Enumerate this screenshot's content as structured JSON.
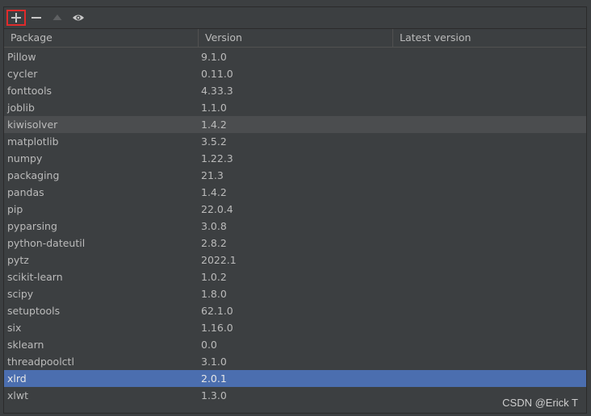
{
  "columns": {
    "package": "Package",
    "version": "Version",
    "latest": "Latest version"
  },
  "toolbar": {
    "add_icon": "plus-icon",
    "remove_icon": "minus-icon",
    "upgrade_icon": "triangle-up-icon",
    "show_icon": "eye-icon"
  },
  "packages": [
    {
      "name": "Pillow",
      "version": "9.1.0",
      "latest": ""
    },
    {
      "name": "cycler",
      "version": "0.11.0",
      "latest": ""
    },
    {
      "name": "fonttools",
      "version": "4.33.3",
      "latest": ""
    },
    {
      "name": "joblib",
      "version": "1.1.0",
      "latest": ""
    },
    {
      "name": "kiwisolver",
      "version": "1.4.2",
      "latest": ""
    },
    {
      "name": "matplotlib",
      "version": "3.5.2",
      "latest": ""
    },
    {
      "name": "numpy",
      "version": "1.22.3",
      "latest": ""
    },
    {
      "name": "packaging",
      "version": "21.3",
      "latest": ""
    },
    {
      "name": "pandas",
      "version": "1.4.2",
      "latest": ""
    },
    {
      "name": "pip",
      "version": "22.0.4",
      "latest": ""
    },
    {
      "name": "pyparsing",
      "version": "3.0.8",
      "latest": ""
    },
    {
      "name": "python-dateutil",
      "version": "2.8.2",
      "latest": ""
    },
    {
      "name": "pytz",
      "version": "2022.1",
      "latest": ""
    },
    {
      "name": "scikit-learn",
      "version": "1.0.2",
      "latest": ""
    },
    {
      "name": "scipy",
      "version": "1.8.0",
      "latest": ""
    },
    {
      "name": "setuptools",
      "version": "62.1.0",
      "latest": ""
    },
    {
      "name": "six",
      "version": "1.16.0",
      "latest": ""
    },
    {
      "name": "sklearn",
      "version": "0.0",
      "latest": ""
    },
    {
      "name": "threadpoolctl",
      "version": "3.1.0",
      "latest": ""
    },
    {
      "name": "xlrd",
      "version": "2.0.1",
      "latest": ""
    },
    {
      "name": "xlwt",
      "version": "1.3.0",
      "latest": ""
    }
  ],
  "hover_row": "kiwisolver",
  "selected_row": "xlrd",
  "colors": {
    "background": "#3c3f41",
    "selection": "#4b6eaf",
    "hover": "#4b4d4f",
    "text": "#bbbbbb",
    "add_highlight": "#e02b2b"
  },
  "watermark": "CSDN @Erick T"
}
